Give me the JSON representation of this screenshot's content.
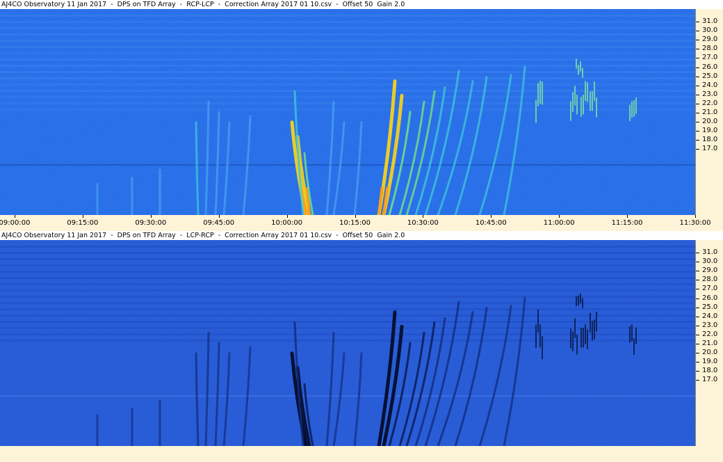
{
  "panels": [
    {
      "title": "AJ4CO Observatory 11 Jan 2017  -  DPS on TFD Array  -  RCP-LCP  -  Correction Array 2017 01 10.csv  -  Offset 50  Gain 2.0",
      "mode": "bright",
      "show_time_axis": true
    },
    {
      "title": "AJ4CO Observatory 11 Jan 2017  -  DPS on TFD Array  -  LCP-RCP  -  Correction Array 2017 01 10.csv  -  Offset 50  Gain 2.0",
      "mode": "dark",
      "show_time_axis": false
    }
  ],
  "frequency_axis": {
    "labels": [
      "31.0",
      "30.0",
      "29.0",
      "28.0",
      "27.0",
      "26.0",
      "25.0",
      "24.0",
      "23.0",
      "22.0",
      "21.0",
      "20.0",
      "19.0",
      "18.0",
      "17.0"
    ]
  },
  "time_axis": {
    "labels": [
      "09:00:00",
      "09:15:00",
      "09:30:00",
      "09:45:00",
      "10:00:00",
      "10:15:00",
      "10:30:00",
      "10:45:00",
      "11:00:00",
      "11:15:00",
      "11:30:00"
    ]
  },
  "colors": {
    "background": "#1f5fe0",
    "axis_bg": "#fdf3d6",
    "burst_bright": "#ffd21a",
    "burst_mid": "#3fe0b0",
    "burst_dark": "#06163f"
  }
}
